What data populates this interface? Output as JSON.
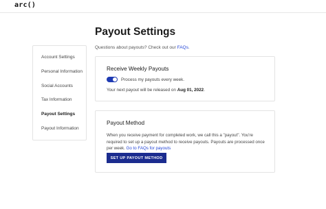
{
  "header": {
    "logo_text": "arc",
    "logo_suffix": "()"
  },
  "page": {
    "title": "Payout Settings",
    "faq_prefix": "Questions about payouts? Check out our ",
    "faq_link": "FAQs",
    "faq_suffix": "."
  },
  "sidebar": {
    "items": [
      {
        "label": "Account Settings",
        "active": false
      },
      {
        "label": "Personal Information",
        "active": false
      },
      {
        "label": "Social Accounts",
        "active": false
      },
      {
        "label": "Tax Information",
        "active": false
      },
      {
        "label": "Payout Settings",
        "active": true
      },
      {
        "label": "Payout Information",
        "active": false
      }
    ]
  },
  "weekly": {
    "title": "Receive Weekly Payouts",
    "toggle_on": true,
    "toggle_label": "Process my payouts every week.",
    "next_prefix": "Your next payout will be released on ",
    "next_date": "Aug 01, 2022",
    "next_suffix": "."
  },
  "method": {
    "title": "Payout Method",
    "description": "When you receive payment for completed work, we call this a \"payout\". You're required to set up a payout method to receive payouts. Payouts are processed once per week. ",
    "description_link": "Go to FAQs for payouts",
    "button_label": "SET UP PAYOUT METHOD"
  },
  "colors": {
    "accent": "#1f3bb3",
    "button": "#1b2c8f",
    "link": "#2445d6"
  }
}
